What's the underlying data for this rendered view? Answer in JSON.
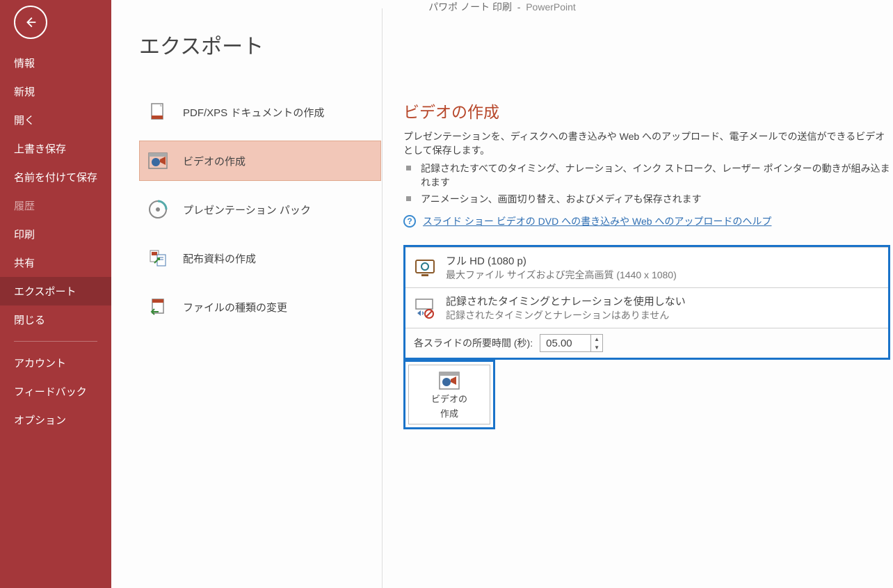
{
  "titlebar": {
    "doc": "パワポ ノート 印刷",
    "sep": "-",
    "app": "PowerPoint"
  },
  "sidebar": {
    "items": [
      {
        "label": "情報"
      },
      {
        "label": "新規"
      },
      {
        "label": "開く"
      },
      {
        "label": "上書き保存"
      },
      {
        "label": "名前を付けて保存"
      },
      {
        "label": "履歴",
        "disabled": true
      },
      {
        "label": "印刷"
      },
      {
        "label": "共有"
      },
      {
        "label": "エクスポート",
        "selected": true
      },
      {
        "label": "閉じる"
      }
    ],
    "items2": [
      {
        "label": "アカウント"
      },
      {
        "label": "フィードバック"
      },
      {
        "label": "オプション"
      }
    ]
  },
  "page_title": "エクスポート",
  "export_options": [
    {
      "label": "PDF/XPS ドキュメントの作成",
      "icon": "pdf"
    },
    {
      "label": "ビデオの作成",
      "icon": "video",
      "selected": true
    },
    {
      "label": "プレゼンテーション パック",
      "icon": "cd"
    },
    {
      "label": "配布資料の作成",
      "icon": "handout"
    },
    {
      "label": "ファイルの種類の変更",
      "icon": "filetype"
    }
  ],
  "detail": {
    "title": "ビデオの作成",
    "desc": "プレゼンテーションを、ディスクへの書き込みや Web へのアップロード、電子メールでの送信ができるビデオとして保存します。",
    "bullets": [
      "記録されたすべてのタイミング、ナレーション、インク ストローク、レーザー ポインターの動きが組み込まれます",
      "アニメーション、画面切り替え、およびメディアも保存されます"
    ],
    "help_link": "スライド ショー ビデオの DVD への書き込みや Web へのアップロードのヘルプ",
    "quality": {
      "title": "フル HD (1080 p)",
      "sub": "最大ファイル サイズおよび完全高画質 (1440 x 1080)"
    },
    "narration": {
      "title": "記録されたタイミングとナレーションを使用しない",
      "sub": "記録されたタイミングとナレーションはありません"
    },
    "timing_label": "各スライドの所要時間 (秒):",
    "timing_value": "05.00",
    "create_button": "ビデオの\n作成",
    "create_button_l1": "ビデオの",
    "create_button_l2": "作成"
  }
}
